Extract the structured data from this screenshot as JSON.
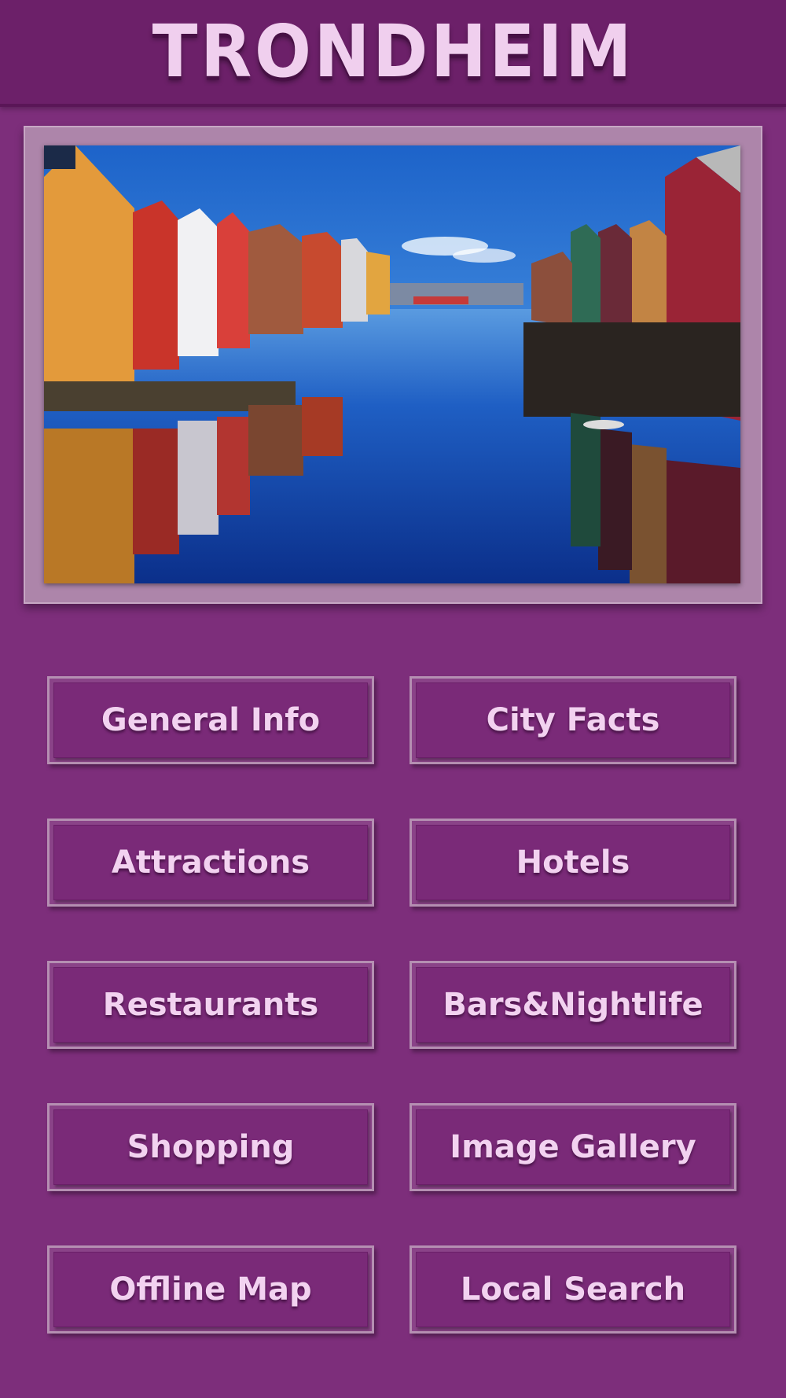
{
  "app": {
    "title": "TRONDHEIM"
  },
  "hero": {
    "image": "trondheim-river-wharf-houses-photo"
  },
  "menu": {
    "items": [
      {
        "label": "General Info"
      },
      {
        "label": "City Facts"
      },
      {
        "label": "Attractions"
      },
      {
        "label": "Hotels"
      },
      {
        "label": "Restaurants"
      },
      {
        "label": "Bars&Nightlife"
      },
      {
        "label": "Shopping"
      },
      {
        "label": "Image Gallery"
      },
      {
        "label": "Offline Map"
      },
      {
        "label": "Local Search"
      }
    ]
  },
  "colors": {
    "background": "#7d2e7b",
    "header": "#6c2069",
    "button_fill": "#7a2a78",
    "button_border": "#b58fb2",
    "text": "#f2d2f0"
  }
}
